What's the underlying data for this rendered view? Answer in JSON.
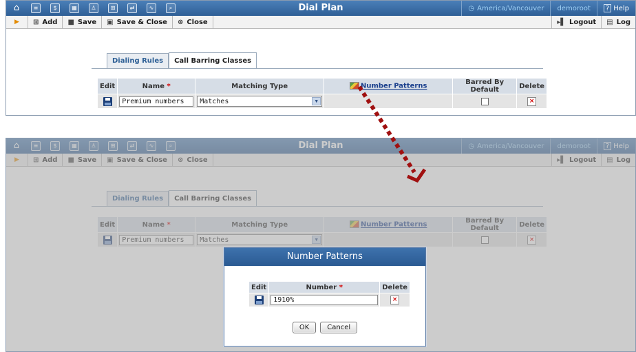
{
  "app": {
    "title": "Dial Plan",
    "timezone": "America/Vancouver",
    "user": "demoroot",
    "help_label": "Help"
  },
  "nav_icons": [
    "home-icon",
    "list-icon",
    "dollar-icon",
    "grid-icon",
    "person-icon",
    "routing-icon",
    "transfer-icon",
    "chart-icon",
    "search-icon"
  ],
  "toolbar": {
    "add_label": "Add",
    "save_label": "Save",
    "save_close_label": "Save & Close",
    "close_label": "Close",
    "logout_label": "Logout",
    "log_label": "Log"
  },
  "tabs": [
    {
      "label": "Dialing Rules",
      "active": false
    },
    {
      "label": "Call Barring Classes",
      "active": true
    }
  ],
  "grid": {
    "columns": {
      "edit": "Edit",
      "name": "Name",
      "matching_type": "Matching Type",
      "number_patterns": "Number Patterns",
      "barred_by_default": "Barred By Default",
      "delete": "Delete"
    },
    "row": {
      "name_value": "Premium numbers",
      "matching_type_value": "Matches",
      "barred_by_default": false
    }
  },
  "dialog": {
    "title": "Number Patterns",
    "columns": {
      "edit": "Edit",
      "number": "Number",
      "delete": "Delete"
    },
    "row": {
      "number_value": "1910%"
    },
    "ok_label": "OK",
    "cancel_label": "Cancel"
  },
  "colors": {
    "header_blue": "#2f5f96",
    "required_red": "#d40000",
    "arrow_red": "#a01010",
    "link_blue": "#1a3f8c"
  }
}
